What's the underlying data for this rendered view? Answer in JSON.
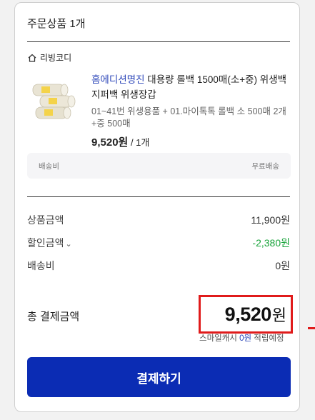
{
  "order": {
    "section_title": "주문상품 1개",
    "shop_name": "리빙코디",
    "product": {
      "brand": "홈에디션명진",
      "name_rest": " 대용량 롤백 1500매(소+중) 위생백 지퍼백 위생장갑",
      "option": "01~41번 위생용품 + 01.마이톡톡 롤백 소 500매 2개+중 500매",
      "price": "9,520원",
      "qty": " / 1개"
    },
    "shipping_box": {
      "label": "배송비",
      "value": "무료배송"
    }
  },
  "summary": {
    "product_amount": {
      "label": "상품금액",
      "value": "11,900원"
    },
    "discount": {
      "label": "할인금액",
      "value": "-2,380원"
    },
    "shipping": {
      "label": "배송비",
      "value": "0원"
    }
  },
  "total": {
    "label": "총 결제금액",
    "amount": "9,520",
    "unit": "원",
    "cash_prefix": "스마일캐시 ",
    "cash_value": "0원",
    "cash_suffix": " 적립예정"
  },
  "pay_button": "결제하기",
  "colors": {
    "accent": "#0b2cb4",
    "discount": "#18a33a",
    "highlight": "#e01b1b",
    "brand_link": "#2a44b8"
  },
  "icons": {
    "shop": "home-icon",
    "discount_toggle": "chevron-down-icon",
    "product_image": "roll-bags-image"
  }
}
